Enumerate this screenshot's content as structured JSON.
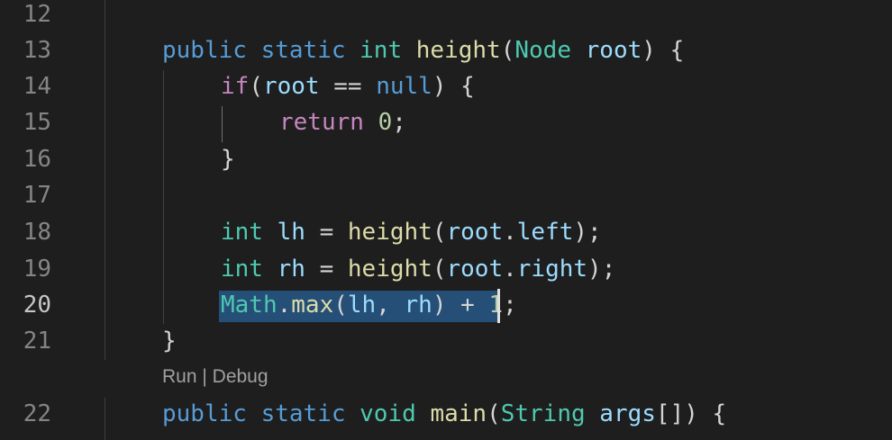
{
  "editor": {
    "lines": [
      {
        "number": "12",
        "indent": 0,
        "tokens": []
      },
      {
        "number": "13",
        "indent": 0,
        "tokens": [
          {
            "text": "public",
            "cls": "k-blue"
          },
          {
            "text": " ",
            "cls": "punc"
          },
          {
            "text": "static",
            "cls": "k-blue"
          },
          {
            "text": " ",
            "cls": "punc"
          },
          {
            "text": "int",
            "cls": "teal"
          },
          {
            "text": " ",
            "cls": "punc"
          },
          {
            "text": "height",
            "cls": "fn"
          },
          {
            "text": "(",
            "cls": "punc"
          },
          {
            "text": "Node",
            "cls": "teal"
          },
          {
            "text": " ",
            "cls": "punc"
          },
          {
            "text": "root",
            "cls": "var"
          },
          {
            "text": ") {",
            "cls": "punc"
          }
        ]
      },
      {
        "number": "14",
        "indent": 1,
        "tokens": [
          {
            "text": "if",
            "cls": "k-purple"
          },
          {
            "text": "(",
            "cls": "punc"
          },
          {
            "text": "root",
            "cls": "var"
          },
          {
            "text": " == ",
            "cls": "punc"
          },
          {
            "text": "null",
            "cls": "k-blue"
          },
          {
            "text": ") {",
            "cls": "punc"
          }
        ]
      },
      {
        "number": "15",
        "indent": 2,
        "tokens": [
          {
            "text": "return",
            "cls": "k-purple"
          },
          {
            "text": " ",
            "cls": "punc"
          },
          {
            "text": "0",
            "cls": "num"
          },
          {
            "text": ";",
            "cls": "punc"
          }
        ]
      },
      {
        "number": "16",
        "indent": 1,
        "tokens": [
          {
            "text": "}",
            "cls": "punc"
          }
        ]
      },
      {
        "number": "17",
        "indent": 0,
        "tokens": []
      },
      {
        "number": "18",
        "indent": 1,
        "tokens": [
          {
            "text": "int",
            "cls": "teal"
          },
          {
            "text": " ",
            "cls": "punc"
          },
          {
            "text": "lh",
            "cls": "var"
          },
          {
            "text": " = ",
            "cls": "punc"
          },
          {
            "text": "height",
            "cls": "fn"
          },
          {
            "text": "(",
            "cls": "punc"
          },
          {
            "text": "root",
            "cls": "var"
          },
          {
            "text": ".",
            "cls": "punc"
          },
          {
            "text": "left",
            "cls": "var"
          },
          {
            "text": ");",
            "cls": "punc"
          }
        ]
      },
      {
        "number": "19",
        "indent": 1,
        "tokens": [
          {
            "text": "int",
            "cls": "teal"
          },
          {
            "text": " ",
            "cls": "punc"
          },
          {
            "text": "rh",
            "cls": "var"
          },
          {
            "text": " = ",
            "cls": "punc"
          },
          {
            "text": "height",
            "cls": "fn"
          },
          {
            "text": "(",
            "cls": "punc"
          },
          {
            "text": "root",
            "cls": "var"
          },
          {
            "text": ".",
            "cls": "punc"
          },
          {
            "text": "right",
            "cls": "var"
          },
          {
            "text": ");",
            "cls": "punc"
          }
        ]
      },
      {
        "number": "20",
        "indent": 1,
        "active": true,
        "tokens": [
          {
            "text": "Math",
            "cls": "teal"
          },
          {
            "text": ".",
            "cls": "punc"
          },
          {
            "text": "max",
            "cls": "fn"
          },
          {
            "text": "(",
            "cls": "punc"
          },
          {
            "text": "lh",
            "cls": "var"
          },
          {
            "text": ", ",
            "cls": "punc"
          },
          {
            "text": "rh",
            "cls": "var"
          },
          {
            "text": ") + ",
            "cls": "punc"
          },
          {
            "text": "1",
            "cls": "num"
          },
          {
            "text": ";",
            "cls": "punc"
          }
        ]
      },
      {
        "number": "21",
        "indent": 0,
        "tokens": [
          {
            "text": "}",
            "cls": "punc"
          }
        ]
      },
      {
        "number": "22",
        "indent": 0,
        "tokens": [
          {
            "text": "public",
            "cls": "k-blue"
          },
          {
            "text": " ",
            "cls": "punc"
          },
          {
            "text": "static",
            "cls": "k-blue"
          },
          {
            "text": " ",
            "cls": "punc"
          },
          {
            "text": "void",
            "cls": "teal"
          },
          {
            "text": " ",
            "cls": "punc"
          },
          {
            "text": "main",
            "cls": "fn"
          },
          {
            "text": "(",
            "cls": "punc"
          },
          {
            "text": "String",
            "cls": "teal"
          },
          {
            "text": " ",
            "cls": "punc"
          },
          {
            "text": "args",
            "cls": "var"
          },
          {
            "text": "[]) {",
            "cls": "punc"
          }
        ]
      }
    ]
  },
  "codelens": {
    "run": "Run",
    "separator": " | ",
    "debug": "Debug"
  },
  "colors": {
    "background": "#1e1e1e",
    "selection": "#264f78",
    "error_squiggle": "#f14c4c",
    "keyword": "#569cd6",
    "control": "#c586c0",
    "type": "#4ec9b0",
    "function": "#dcdcaa",
    "variable": "#9cdcfe",
    "number": "#b5cea8"
  }
}
